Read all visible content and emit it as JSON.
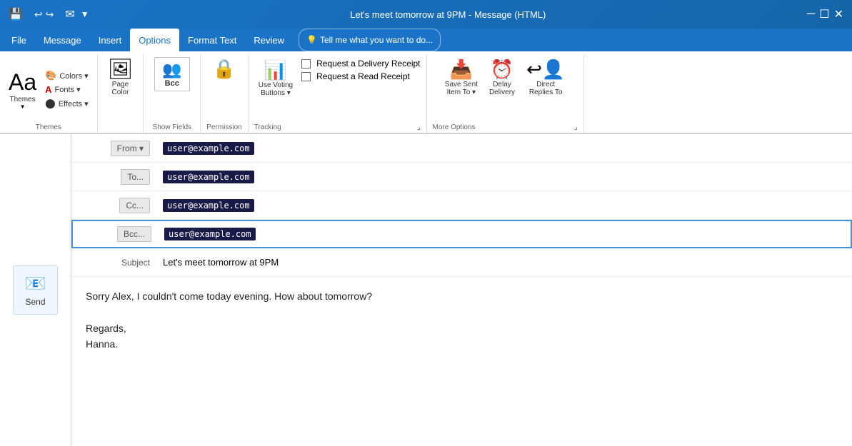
{
  "titlebar": {
    "title": "Let's meet tomorrow at 9PM - Message (HTML)",
    "save_icon": "💾",
    "undo_icon": "↩",
    "redo_icon": "↪",
    "up_arrow": "▲",
    "down_arrow": "▼"
  },
  "menubar": {
    "items": [
      {
        "label": "File",
        "active": false
      },
      {
        "label": "Message",
        "active": false
      },
      {
        "label": "Insert",
        "active": false
      },
      {
        "label": "Options",
        "active": true
      },
      {
        "label": "Format Text",
        "active": false
      },
      {
        "label": "Review",
        "active": false
      }
    ],
    "tell_me": "Tell me what you want to do..."
  },
  "ribbon": {
    "groups": {
      "themes": {
        "label": "Themes",
        "main_btn": "Aa",
        "sub_items": [
          {
            "label": "Colors ▾",
            "icon": "🎨"
          },
          {
            "label": "Fonts ▾",
            "icon": "A"
          },
          {
            "label": "Effects ▾",
            "icon": "⬤"
          }
        ]
      },
      "page_color": {
        "label": "Page Color",
        "icon": "🖼"
      },
      "show_fields": {
        "label": "Show Fields",
        "bcc_label": "Bcc"
      },
      "permission": {
        "label": "Permission"
      },
      "tracking": {
        "label": "Tracking",
        "delivery_receipt": "Request a Delivery Receipt",
        "read_receipt": "Request a Read Receipt",
        "use_voting": "Use Voting\nButtons ▾",
        "dialog_launcher": "⌟"
      },
      "more_options": {
        "label": "More Options",
        "save_sent": "Save Sent\nItem To ▾",
        "delay_delivery": "Delay\nDelivery",
        "direct_replies": "Direct\nReplies To",
        "dialog_launcher": "⌟"
      }
    }
  },
  "compose": {
    "send_label": "Send",
    "from_label": "From ▾",
    "to_label": "To...",
    "cc_label": "Cc...",
    "bcc_label": "Bcc...",
    "subject_label": "Subject",
    "from_value": "user@example.com",
    "to_value": "user@example.com",
    "cc_value": "user@example.com",
    "bcc_value": "user@example.com",
    "subject_value": "Let's meet tomorrow at 9PM",
    "body_line1": "Sorry Alex, I couldn't come today evening. How about tomorrow?",
    "body_line2": "",
    "body_line3": "Regards,",
    "body_line4": "Hanna."
  }
}
